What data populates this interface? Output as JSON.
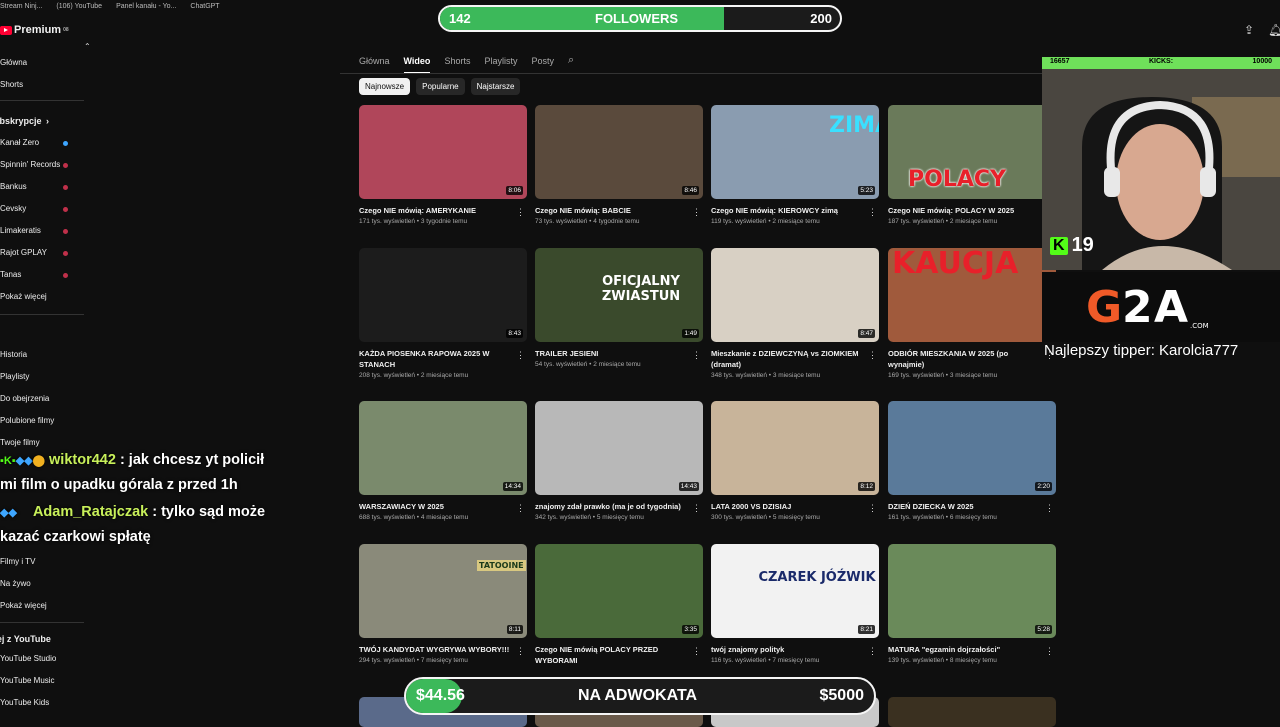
{
  "bookmarks": [
    "Stream Ninj...",
    "(106) YouTube",
    "Panel kanału - Yo...",
    "ChatGPT"
  ],
  "sidebar": {
    "logo": "Premium",
    "logo_sup": "08",
    "items1": [
      "Główna",
      "Shorts"
    ],
    "subs_header": "Subskrypcje",
    "subs": [
      "Kanał Zero",
      "Spinnin' Records",
      "Bankus",
      "Cevsky",
      "Limakeratis",
      "Rajot GPLAY",
      "Tanas",
      "Pokaż więcej"
    ],
    "you": [
      "Historia",
      "Playlisty",
      "Do obejrzenia",
      "Polubione filmy",
      "Twoje filmy"
    ],
    "explore": [
      "Filmy i TV",
      "Na żywo",
      "Pokaż więcej"
    ],
    "more_header": "Więcej z YouTube",
    "more": [
      "YouTube Studio",
      "YouTube Music",
      "YouTube Kids"
    ]
  },
  "channel_tabs": [
    "Główna",
    "Wideo",
    "Shorts",
    "Playlisty",
    "Posty"
  ],
  "active_tab": "Wideo",
  "chips": [
    "Najnowsze",
    "Popularne",
    "Najstarsze"
  ],
  "videos": [
    {
      "title": "Czego NIE mówią: AMERYKANIE",
      "meta": "171 tys. wyświetleń • 3 tygodnie temu",
      "duration": "8:06",
      "thumb_text": "",
      "thumb_bg": "#b0465a"
    },
    {
      "title": "Czego NIE mówią: BABCIE",
      "meta": "73 tys. wyświetleń • 4 tygodnie temu",
      "duration": "8:46",
      "thumb_text": "",
      "thumb_bg": "#5a4a3c"
    },
    {
      "title": "Czego NIE mówią: KIEROWCY zimą",
      "meta": "119 tys. wyświetleń • 2 miesiące temu",
      "duration": "5:23",
      "thumb_text": "ZIMA",
      "thumb_bg": "#8a9cb0"
    },
    {
      "title": "Czego NIE mówią: POLACY W 2025",
      "meta": "187 tys. wyświetleń • 2 miesiące temu",
      "duration": "",
      "thumb_text": "POLACY",
      "thumb_bg": "#6a7a5a"
    },
    {
      "title": "KAŻDA PIOSENKA RAPOWA 2025 W STANACH",
      "meta": "208 tys. wyświetleń • 2 miesiące temu",
      "duration": "8:43",
      "thumb_text": "",
      "thumb_bg": "#1c1c1c"
    },
    {
      "title": "TRAILER JESIENI",
      "meta": "54 tys. wyświetleń • 2 miesiące temu",
      "duration": "1:49",
      "thumb_text": "OFICJALNY ZWIASTUN",
      "thumb_bg": "#3a4a2c"
    },
    {
      "title": "Mieszkanie z DZIEWCZYNĄ vs ZIOMKIEM (dramat)",
      "meta": "348 tys. wyświetleń • 3 miesiące temu",
      "duration": "8:47",
      "thumb_text": "",
      "thumb_bg": "#d8d0c4"
    },
    {
      "title": "ODBIÓR MIESZKANIA W 2025 (po wynajmie)",
      "meta": "169 tys. wyświetleń • 3 miesiące temu",
      "duration": "",
      "thumb_text": "KAUCJA",
      "thumb_bg": "#a05a3c"
    },
    {
      "title": "WARSZAWIACY W 2025",
      "meta": "688 tys. wyświetleń • 4 miesiące temu",
      "duration": "14:34",
      "thumb_text": "",
      "thumb_bg": "#7a8a6c"
    },
    {
      "title": "znajomy zdał prawko (ma je od tygodnia)",
      "meta": "342 tys. wyświetleń • 5 miesięcy temu",
      "duration": "14:43",
      "thumb_text": "",
      "thumb_bg": "#b8b8b8"
    },
    {
      "title": "LATA 2000 VS DZISIAJ",
      "meta": "300 tys. wyświetleń • 5 miesięcy temu",
      "duration": "8:12",
      "thumb_text": "",
      "thumb_bg": "#c8b49a"
    },
    {
      "title": "DZIEŃ DZIECKA W 2025",
      "meta": "161 tys. wyświetleń • 6 miesięcy temu",
      "duration": "2:20",
      "thumb_text": "",
      "thumb_bg": "#5a7a9a"
    },
    {
      "title": "TWÓJ KANDYDAT WYGRYWA WYBORY!!!",
      "meta": "294 tys. wyświetleń • 7 miesięcy temu",
      "duration": "8:11",
      "thumb_text": "TATOOINE",
      "thumb_bg": "#8a8a7a"
    },
    {
      "title": "Czego NIE mówią POLACY PRZED WYBORAMI",
      "meta": "",
      "duration": "3:35",
      "thumb_text": "",
      "thumb_bg": "#4a6a3a"
    },
    {
      "title": "twój znajomy polityk",
      "meta": "116 tys. wyświetleń • 7 miesięcy temu",
      "duration": "8:21",
      "thumb_text": "CZAREK JÓŹWIK",
      "thumb_bg": "#f2f2f2"
    },
    {
      "title": "MATURA \"egzamin dojrzałości\"",
      "meta": "139 tys. wyświetleń • 8 miesięcy temu",
      "duration": "5:28",
      "thumb_text": "",
      "thumb_bg": "#6a8a5a"
    }
  ],
  "overlay": {
    "followers_current": "142",
    "followers_label": "FOLLOWERS",
    "followers_goal": "200",
    "followers_progress": 0.71,
    "kicks_left": "16657",
    "kicks_label": "KICKS:",
    "kicks_right": "10000",
    "kick_count": "19",
    "sponsor": "G2A",
    "sponsor_sub": ".COM",
    "tipper": "Najlepszy tipper: Karolcia777",
    "chat": [
      {
        "user": "wiktor442",
        "text": ": jak chcesz yt policił",
        "cont": "mi film o upadku górala z przed 1h"
      },
      {
        "user": "Adam_Ratajczak",
        "text": ": tylko sąd może",
        "cont": "kazać czarkowi spłatę"
      }
    ],
    "donate_current": "$44.56",
    "donate_label": "NA ADWOKATA",
    "donate_goal": "$5000",
    "donate_progress": 0.07
  },
  "colors": {
    "accent_green": "#3cb95a",
    "kick_green": "#53fc18",
    "yt_red": "#ff0033",
    "chat_user": "#c8f05a"
  }
}
